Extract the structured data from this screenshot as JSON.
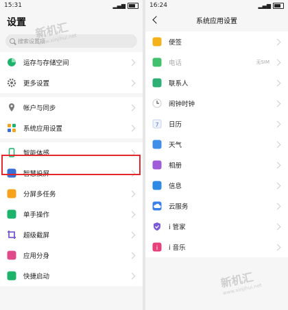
{
  "left": {
    "status": {
      "time": "15:31"
    },
    "title": "设置",
    "search": {
      "placeholder": "搜索设置项"
    },
    "groups": [
      [
        {
          "label": "运存与存储空间",
          "icon": "storage-pie-icon",
          "color": "#1cb36b"
        },
        {
          "label": "更多设置",
          "icon": "gear-icon",
          "color": "#6f6f6f"
        }
      ],
      [
        {
          "label": "帐户与同步",
          "icon": "location-pin-icon",
          "color": "#7a7a7a"
        },
        {
          "label": "系统应用设置",
          "icon": "app-grid-icon",
          "color": "#f6a21a"
        }
      ],
      [
        {
          "label": "智能体感",
          "icon": "phone-outline-icon",
          "color": "#1cb36b"
        },
        {
          "label": "智慧投屏",
          "icon": "screen-cast-icon",
          "color": "#3b6fd8"
        },
        {
          "label": "分屏多任务",
          "icon": "split-screen-icon",
          "color": "#f6a21a"
        },
        {
          "label": "单手操作",
          "icon": "one-hand-icon",
          "color": "#1cb36b"
        },
        {
          "label": "超级截屏",
          "icon": "crop-icon",
          "color": "#7b57d3"
        },
        {
          "label": "应用分身",
          "icon": "app-clone-icon",
          "color": "#e04a8b"
        },
        {
          "label": "快捷启动",
          "icon": "quick-launch-icon",
          "color": "#1cb36b"
        }
      ]
    ]
  },
  "right": {
    "status": {
      "time": "16:24"
    },
    "title": "系统应用设置",
    "items": [
      {
        "label": "便签",
        "icon": "notes-icon",
        "color": "#f3b11a"
      },
      {
        "label": "电话",
        "icon": "phone-icon",
        "color": "#42c06c",
        "sub": "无SIM",
        "disabled": true
      },
      {
        "label": "联系人",
        "icon": "contacts-icon",
        "color": "#2eaf74"
      },
      {
        "label": "闹钟时钟",
        "icon": "clock-icon",
        "color": "#555555"
      },
      {
        "label": "日历",
        "icon": "calendar-icon",
        "color": "#4a78d6",
        "glyph": "7"
      },
      {
        "label": "天气",
        "icon": "weather-icon",
        "color": "#3f8fe8"
      },
      {
        "label": "相册",
        "icon": "gallery-icon",
        "color": "#a05bd8"
      },
      {
        "label": "信息",
        "icon": "message-icon",
        "color": "#2f8ae6"
      },
      {
        "label": "云服务",
        "icon": "cloud-icon",
        "color": "#3b7fe8"
      },
      {
        "label": "i 管家",
        "icon": "shield-icon",
        "color": "#7b5cd8"
      },
      {
        "label": "i 音乐",
        "icon": "music-icon",
        "color": "#e7407a"
      }
    ]
  },
  "watermark": {
    "brand": "新机汇",
    "site": "www.xinjihui.net"
  }
}
